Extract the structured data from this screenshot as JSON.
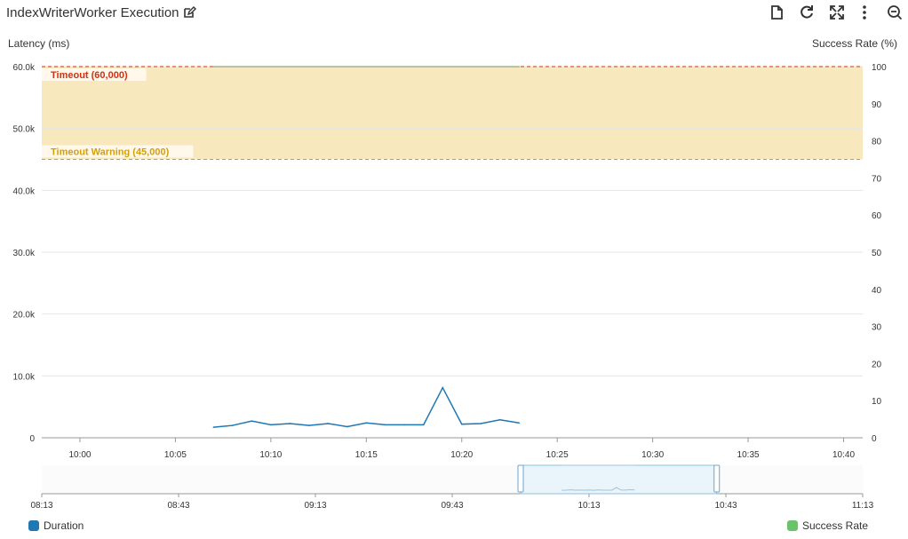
{
  "header": {
    "title": "IndexWriterWorker Execution",
    "tools": [
      "edit-icon",
      "document-icon",
      "refresh-icon",
      "expand-icon",
      "more-icon",
      "zoom-out-icon"
    ]
  },
  "chart_data": {
    "type": "line",
    "ylabel_left": "Latency (ms)",
    "ylabel_right": "Success Rate (%)",
    "y_left_ticks": [
      "60.0k",
      "50.0k",
      "40.0k",
      "30.0k",
      "20.0k",
      "10.0k",
      "0"
    ],
    "y_left_range": [
      0,
      60000
    ],
    "y_right_ticks": [
      "100",
      "90",
      "80",
      "70",
      "60",
      "50",
      "40",
      "30",
      "20",
      "10",
      "0"
    ],
    "y_right_range": [
      0,
      100
    ],
    "x_ticks": [
      "10:00",
      "10:05",
      "10:10",
      "10:15",
      "10:20",
      "10:25",
      "10:30",
      "10:35",
      "10:40"
    ],
    "x_range": [
      "09:58",
      "10:41"
    ],
    "grid": true,
    "thresholds": [
      {
        "label": "Timeout (60,000)",
        "value": 60000,
        "color": "#d13212"
      },
      {
        "label": "Timeout Warning (45,000)",
        "value": 45000,
        "color": "#d6a100"
      }
    ],
    "band": {
      "from": 45000,
      "to": 60000,
      "color": "#f7e9bd"
    },
    "series": [
      {
        "name": "Duration",
        "color": "#1f77b4",
        "axis": "left",
        "x": [
          "10:07",
          "10:08",
          "10:09",
          "10:10",
          "10:11",
          "10:12",
          "10:13",
          "10:14",
          "10:15",
          "10:16",
          "10:17",
          "10:18",
          "10:19",
          "10:20",
          "10:21",
          "10:22",
          "10:23"
        ],
        "values": [
          1700,
          2000,
          2700,
          2100,
          2300,
          2000,
          2300,
          1800,
          2400,
          2100,
          2100,
          2100,
          8100,
          2200,
          2300,
          2900,
          2400
        ]
      },
      {
        "name": "Success Rate",
        "color": "#6ac36a",
        "axis": "right",
        "x": [
          "10:07",
          "10:23"
        ],
        "values": [
          100,
          100
        ]
      }
    ],
    "navigator": {
      "x_ticks": [
        "08:13",
        "08:43",
        "09:13",
        "09:43",
        "10:13",
        "10:43",
        "11:13"
      ],
      "selection": [
        "09:58",
        "10:41"
      ]
    },
    "legend": [
      "Duration",
      "Success Rate"
    ],
    "legend_placement": "bottom"
  }
}
